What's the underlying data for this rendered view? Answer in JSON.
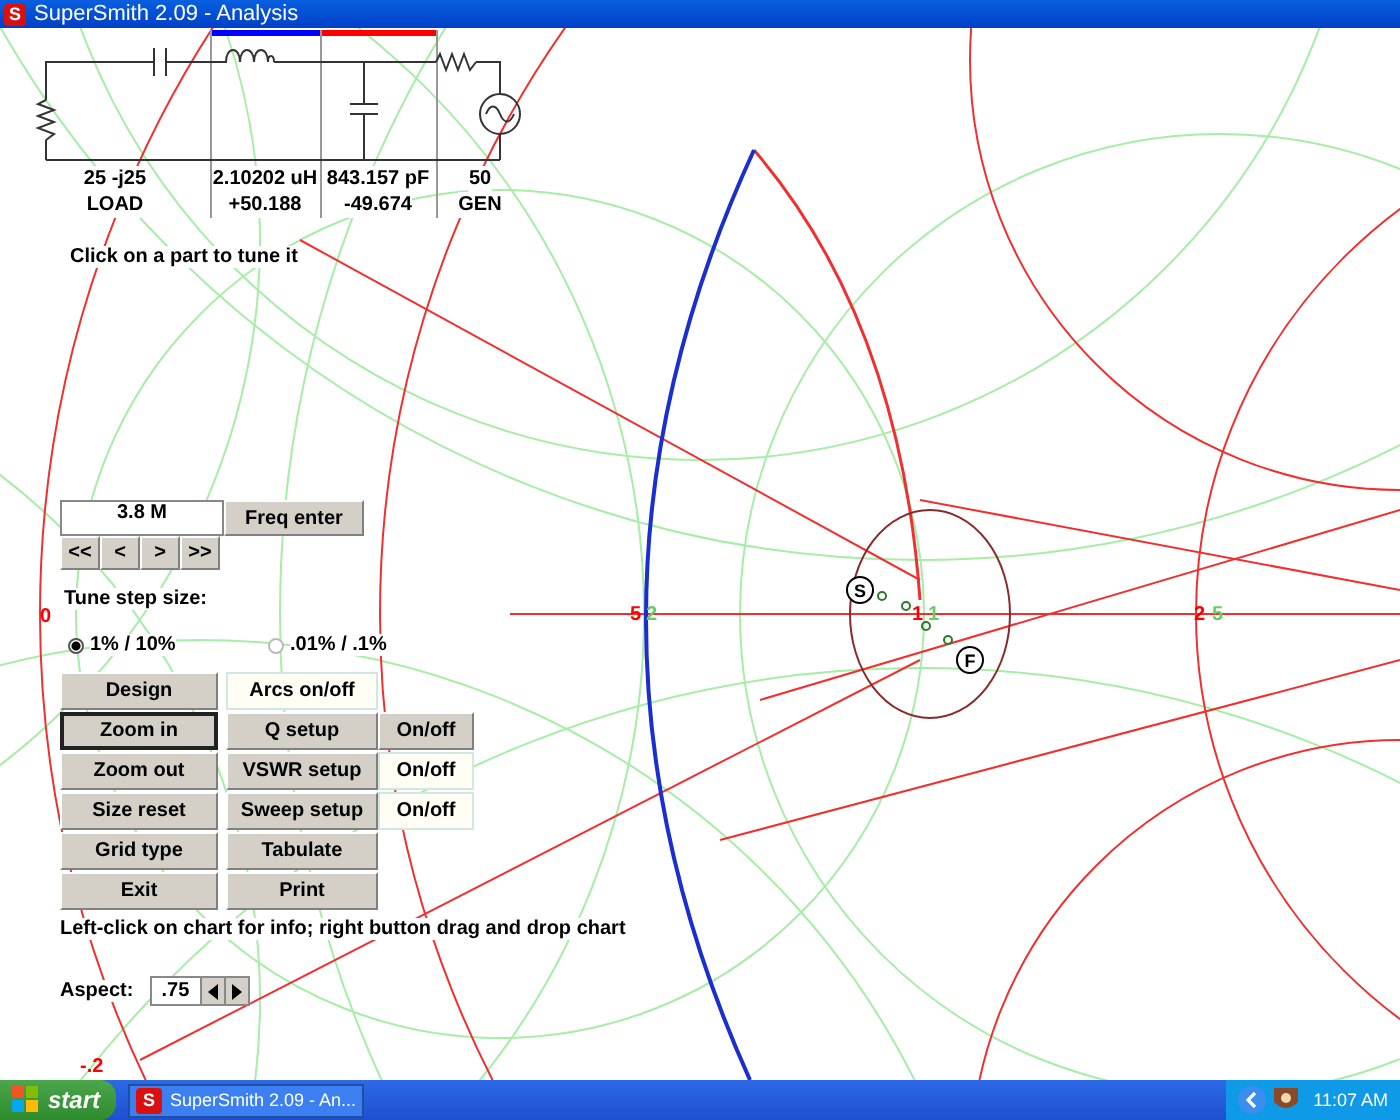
{
  "title_bar": {
    "icon_text": "S",
    "title": "SuperSmith 2.09 - Analysis"
  },
  "circuit": {
    "parts": [
      {
        "kind": "load",
        "value": "25  -j25",
        "reading": "LOAD"
      },
      {
        "kind": "inductor",
        "value": "2.10202 uH",
        "reading": "+50.188",
        "color": "#0000ff"
      },
      {
        "kind": "capacitor",
        "value": "843.157 pF",
        "reading": "-49.674",
        "color": "#ff0000"
      },
      {
        "kind": "generator",
        "value": "50",
        "reading": "GEN"
      }
    ]
  },
  "hint": "Click on a part to tune it",
  "frequency": {
    "value": "3.8 M",
    "enter_button": "Freq enter",
    "step_buttons": [
      "<<",
      "<",
      ">",
      ">>"
    ]
  },
  "tune_step": {
    "label": "Tune step size:",
    "options": [
      {
        "label": "1% / 10%",
        "selected": true
      },
      {
        "label": ".01% / .1%",
        "selected": false
      }
    ]
  },
  "button_rows": [
    [
      {
        "label": "Design",
        "on": false,
        "focused": false
      },
      {
        "label": "Arcs on/off",
        "on": true,
        "focused": false
      }
    ],
    [
      {
        "label": "Zoom in",
        "on": false,
        "focused": true
      },
      {
        "label": "Q setup",
        "on": false,
        "focused": false
      },
      {
        "label": "On/off",
        "on": false,
        "focused": false
      }
    ],
    [
      {
        "label": "Zoom out",
        "on": false,
        "focused": false
      },
      {
        "label": "VSWR setup",
        "on": false,
        "focused": false
      },
      {
        "label": "On/off",
        "on": true,
        "focused": false
      }
    ],
    [
      {
        "label": "Size reset",
        "on": false,
        "focused": false
      },
      {
        "label": "Sweep setup",
        "on": false,
        "focused": false
      },
      {
        "label": "On/off",
        "on": true,
        "focused": false
      }
    ],
    [
      {
        "label": "Grid type",
        "on": false,
        "focused": false
      },
      {
        "label": "Tabulate",
        "on": false,
        "focused": false
      }
    ],
    [
      {
        "label": "Exit",
        "on": false,
        "focused": false
      },
      {
        "label": "Print",
        "on": false,
        "focused": false
      }
    ]
  ],
  "info": "Left-click on chart for info; right button drag and drop chart",
  "aspect": {
    "label": "Aspect:",
    "value": ".75"
  },
  "chart": {
    "labels": [
      {
        "text": "0",
        "color": "#ff0000"
      },
      {
        "text": "-.2",
        "color": "#ff0000"
      },
      {
        "text": "5",
        "color": "#ff0000"
      },
      {
        "text": "2",
        "color": "#66cc66"
      },
      {
        "text": "1",
        "color": "#ff0000"
      },
      {
        "text": "1",
        "color": "#66cc66"
      },
      {
        "text": "2",
        "color": "#ff0000"
      },
      {
        "text": "5",
        "color": "#66cc66"
      }
    ],
    "markers": [
      "S",
      "F"
    ]
  },
  "taskbar": {
    "start": "start",
    "task": {
      "icon_text": "S",
      "label": "SuperSmith 2.09 - An..."
    },
    "clock": "11:07 AM"
  }
}
